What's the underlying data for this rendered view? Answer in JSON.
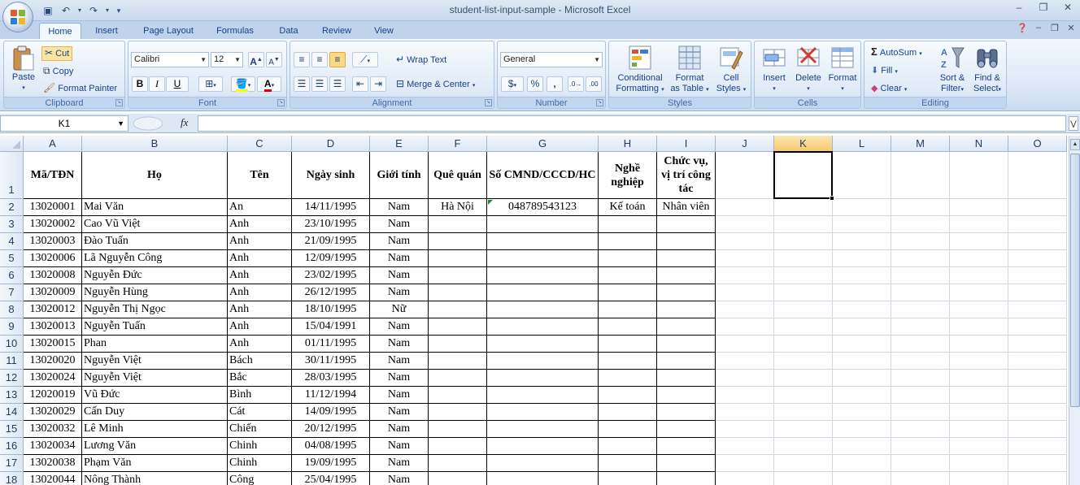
{
  "window": {
    "title": "student-list-input-sample - Microsoft Excel",
    "controls": [
      "–",
      "❐",
      "✕"
    ]
  },
  "tabs": [
    "Home",
    "Insert",
    "Page Layout",
    "Formulas",
    "Data",
    "Review",
    "View"
  ],
  "active_tab": "Home",
  "ribbon": {
    "clipboard": {
      "label": "Clipboard",
      "paste": "Paste",
      "cut": "Cut",
      "copy": "Copy",
      "format_painter": "Format Painter"
    },
    "font": {
      "label": "Font",
      "font_name": "Calibri",
      "font_size": "12",
      "bold": "B",
      "italic": "I",
      "underline": "U"
    },
    "alignment": {
      "label": "Alignment",
      "wrap_text": "Wrap Text",
      "merge_center": "Merge & Center"
    },
    "number": {
      "label": "Number",
      "format": "General",
      "currency": "$",
      "percent": "%",
      "comma": ","
    },
    "styles": {
      "label": "Styles",
      "conditional": "Conditional",
      "conditional2": "Formatting",
      "format_table": "Format",
      "format_table2": "as Table",
      "cell_styles": "Cell",
      "cell_styles2": "Styles"
    },
    "cells": {
      "label": "Cells",
      "insert": "Insert",
      "delete": "Delete",
      "format": "Format"
    },
    "editing": {
      "label": "Editing",
      "autosum": "AutoSum",
      "fill": "Fill",
      "clear": "Clear",
      "sort": "Sort &",
      "sort2": "Filter",
      "find": "Find &",
      "find2": "Select"
    }
  },
  "formula_bar": {
    "name_box": "K1",
    "fx": "fx",
    "formula": ""
  },
  "columns": [
    "A",
    "B",
    "C",
    "D",
    "E",
    "F",
    "G",
    "H",
    "I",
    "J",
    "K",
    "L",
    "M",
    "N",
    "O"
  ],
  "selected_column": "K",
  "header_row": {
    "row_number": "1",
    "cells": [
      "Mã/TĐN",
      "Họ",
      "Tên",
      "Ngày sinh",
      "Giới tính",
      "Quê quán",
      "Số CMND/CCCD/HC",
      "Nghề nghiệp",
      "Chức vụ, vị trí công tác"
    ]
  },
  "rows": [
    {
      "n": "2",
      "a": "13020001",
      "b": "Mai Văn",
      "c": "An",
      "d": "14/11/1995",
      "e": "Nam",
      "f": "Hà Nội",
      "g": "048789543123",
      "h": "Kế toán",
      "i": "Nhân viên"
    },
    {
      "n": "3",
      "a": "13020002",
      "b": "Cao Vũ Việt",
      "c": "Anh",
      "d": "23/10/1995",
      "e": "Nam",
      "f": "",
      "g": "",
      "h": "",
      "i": ""
    },
    {
      "n": "4",
      "a": "13020003",
      "b": "Đào Tuấn",
      "c": "Anh",
      "d": "21/09/1995",
      "e": "Nam",
      "f": "",
      "g": "",
      "h": "",
      "i": ""
    },
    {
      "n": "5",
      "a": "13020006",
      "b": "Lã Nguyễn Công",
      "c": "Anh",
      "d": "12/09/1995",
      "e": "Nam",
      "f": "",
      "g": "",
      "h": "",
      "i": ""
    },
    {
      "n": "6",
      "a": "13020008",
      "b": "Nguyễn Đức",
      "c": "Anh",
      "d": "23/02/1995",
      "e": "Nam",
      "f": "",
      "g": "",
      "h": "",
      "i": ""
    },
    {
      "n": "7",
      "a": "13020009",
      "b": "Nguyễn Hùng",
      "c": "Anh",
      "d": "26/12/1995",
      "e": "Nam",
      "f": "",
      "g": "",
      "h": "",
      "i": ""
    },
    {
      "n": "8",
      "a": "13020012",
      "b": "Nguyễn Thị Ngọc",
      "c": "Anh",
      "d": "18/10/1995",
      "e": "Nữ",
      "f": "",
      "g": "",
      "h": "",
      "i": ""
    },
    {
      "n": "9",
      "a": "13020013",
      "b": "Nguyễn Tuấn",
      "c": "Anh",
      "d": "15/04/1991",
      "e": "Nam",
      "f": "",
      "g": "",
      "h": "",
      "i": ""
    },
    {
      "n": "10",
      "a": "13020015",
      "b": "Phan",
      "c": "Anh",
      "d": "01/11/1995",
      "e": "Nam",
      "f": "",
      "g": "",
      "h": "",
      "i": ""
    },
    {
      "n": "11",
      "a": "13020020",
      "b": "Nguyễn Việt",
      "c": "Bách",
      "d": "30/11/1995",
      "e": "Nam",
      "f": "",
      "g": "",
      "h": "",
      "i": ""
    },
    {
      "n": "12",
      "a": "13020024",
      "b": "Nguyễn Việt",
      "c": "Bắc",
      "d": "28/03/1995",
      "e": "Nam",
      "f": "",
      "g": "",
      "h": "",
      "i": ""
    },
    {
      "n": "13",
      "a": "12020019",
      "b": "Vũ Đức",
      "c": "Bình",
      "d": "11/12/1994",
      "e": "Nam",
      "f": "",
      "g": "",
      "h": "",
      "i": ""
    },
    {
      "n": "14",
      "a": "13020029",
      "b": "Cấn Duy",
      "c": "Cát",
      "d": "14/09/1995",
      "e": "Nam",
      "f": "",
      "g": "",
      "h": "",
      "i": ""
    },
    {
      "n": "15",
      "a": "13020032",
      "b": "Lê Minh",
      "c": "Chiến",
      "d": "20/12/1995",
      "e": "Nam",
      "f": "",
      "g": "",
      "h": "",
      "i": ""
    },
    {
      "n": "16",
      "a": "13020034",
      "b": "Lương Văn",
      "c": "Chinh",
      "d": "04/08/1995",
      "e": "Nam",
      "f": "",
      "g": "",
      "h": "",
      "i": ""
    },
    {
      "n": "17",
      "a": "13020038",
      "b": "Phạm Văn",
      "c": "Chinh",
      "d": "19/09/1995",
      "e": "Nam",
      "f": "",
      "g": "",
      "h": "",
      "i": ""
    },
    {
      "n": "18",
      "a": "13020044",
      "b": "Nông Thành",
      "c": "Công",
      "d": "25/04/1995",
      "e": "Nam",
      "f": "",
      "g": "",
      "h": "",
      "i": ""
    }
  ]
}
